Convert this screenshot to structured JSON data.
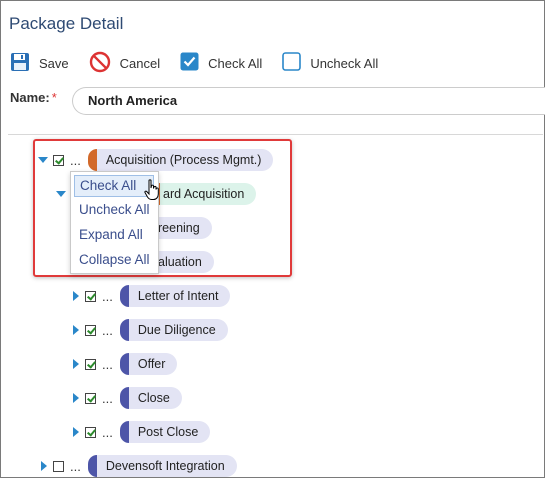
{
  "page": {
    "title": "Package Detail"
  },
  "toolbar": {
    "save_label": "Save",
    "cancel_label": "Cancel",
    "check_all_label": "Check All",
    "uncheck_all_label": "Uncheck All"
  },
  "form": {
    "name_label": "Name:",
    "required_mark": "*",
    "name_value": "North America"
  },
  "tree": {
    "dots": "...",
    "items": [
      {
        "label": "Acquisition (Process Mgmt.)",
        "checked": true,
        "expanded": true
      },
      {
        "label": "Standard Acquisition",
        "visible_text": "ard Acquisition",
        "expanded": true
      },
      {
        "label": "Screening",
        "visible_text": "reening"
      },
      {
        "label": "Evaluation",
        "visible_text": "aluation"
      },
      {
        "label": "Letter of Intent",
        "checked": true
      },
      {
        "label": "Due Diligence",
        "checked": true
      },
      {
        "label": "Offer",
        "checked": true
      },
      {
        "label": "Close",
        "checked": true
      },
      {
        "label": "Post Close",
        "checked": true
      },
      {
        "label": "Devensoft Integration",
        "checked": false
      }
    ]
  },
  "context_menu": {
    "items": [
      {
        "label": "Check All",
        "active": true
      },
      {
        "label": "Uncheck All"
      },
      {
        "label": "Expand All"
      },
      {
        "label": "Collapse All"
      }
    ]
  },
  "colors": {
    "accent": "#2a87c9",
    "highlight_border": "#e03a3a",
    "pill_bg": "#e3e4f4",
    "pill_marker": "#4d55a8",
    "root_marker": "#d2692a"
  }
}
